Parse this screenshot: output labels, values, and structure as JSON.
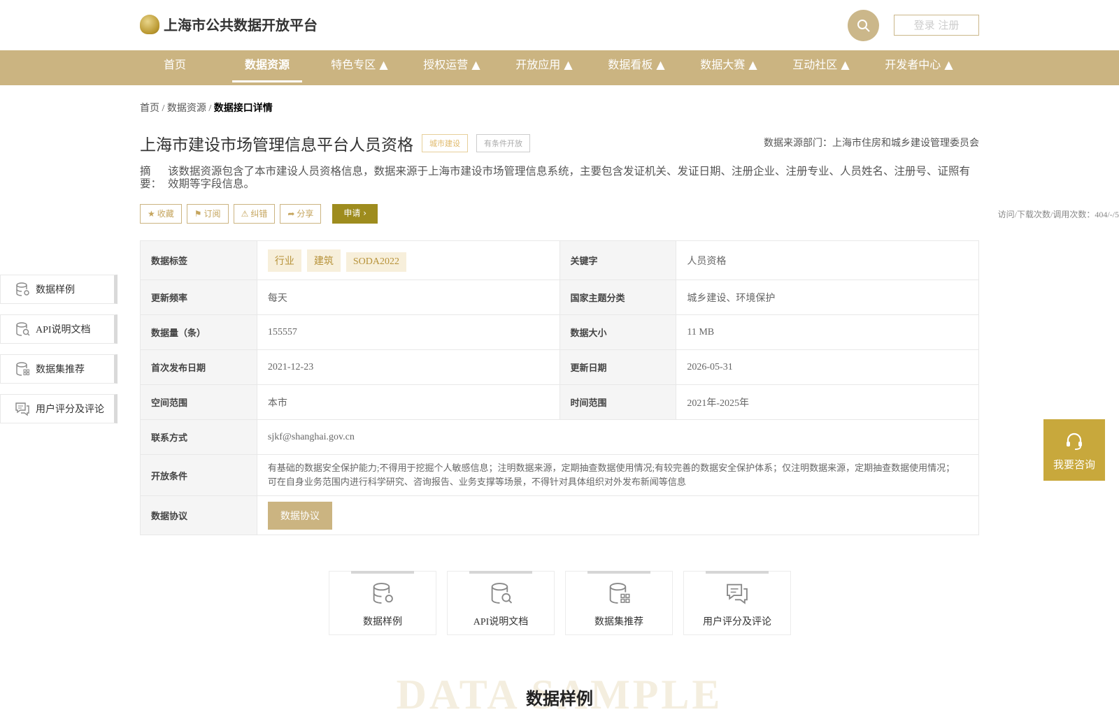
{
  "header": {
    "logo_text": "上海市公共数据开放平台",
    "login_label": "登录 注册"
  },
  "nav": [
    "首页",
    "数据资源",
    "特色专区 ▲",
    "授权运营 ▲",
    "开放应用 ▲",
    "数据看板 ▲",
    "数据大赛 ▲",
    "互动社区 ▲",
    "开发者中心 ▲"
  ],
  "breadcrumb": {
    "home": "首页",
    "sep1": " / ",
    "section": "数据资源",
    "sep2": " / ",
    "current": "数据接口详情"
  },
  "dataset": {
    "title": "上海市建设市场管理信息平台人员资格",
    "tag1": "城市建设",
    "tag2": "有条件开放",
    "source": "数据来源部门：上海市住房和城乡建设管理委员会",
    "summary_label": "摘　要：",
    "summary": "该数据资源包含了本市建设人员资格信息，数据来源于上海市建设市场管理信息系统，主要包含发证机关、发证日期、注册企业、注册专业、人员姓名、注册号、证照有效期等字段信息。"
  },
  "actions": {
    "collect": "收藏",
    "subscribe": "订阅",
    "correct": "纠错",
    "share": "分享",
    "apply": "申请"
  },
  "visits": "访问/下载次数/调用次数：404/-/5",
  "table": {
    "tags_k": "数据标签",
    "tags": [
      "行业",
      "建筑",
      "SODA2022"
    ],
    "keyword_k": "关键字",
    "keyword": "人员资格",
    "freq_k": "更新频率",
    "freq": "每天",
    "theme_k": "国家主题分类",
    "theme": "城乡建设、环境保护",
    "count_k": "数据量（条）",
    "count": "155557",
    "size_k": "数据大小",
    "size": "11 MB",
    "first_k": "首次发布日期",
    "first": "2021-12-23",
    "updated_k": "更新日期",
    "updated": "2026-05-31",
    "space_k": "空间范围",
    "space": "本市",
    "time_k": "时间范围",
    "time": "2021年-2025年",
    "contact_k": "联系方式",
    "contact": "sjkf@shanghai.gov.cn",
    "cond_k": "开放条件",
    "cond": "有基础的数据安全保护能力;不得用于挖掘个人敏感信息；注明数据来源，定期抽查数据使用情况;有较完善的数据安全保护体系；仅注明数据来源，定期抽查数据使用情况；可在自身业务范围内进行科学研究、咨询报告、业务支撑等场景，不得针对具体组织对外发布新闻等信息",
    "proto_k": "数据协议",
    "proto_btn": "数据协议"
  },
  "side": [
    "数据样例",
    "API说明文档",
    "数据集推荐",
    "用户评分及评论"
  ],
  "consult": "我要咨询",
  "cards": [
    "数据样例",
    "API说明文档",
    "数据集推荐",
    "用户评分及评论"
  ],
  "section": {
    "bg": "DATA SAMPLE",
    "title": "数据样例"
  }
}
